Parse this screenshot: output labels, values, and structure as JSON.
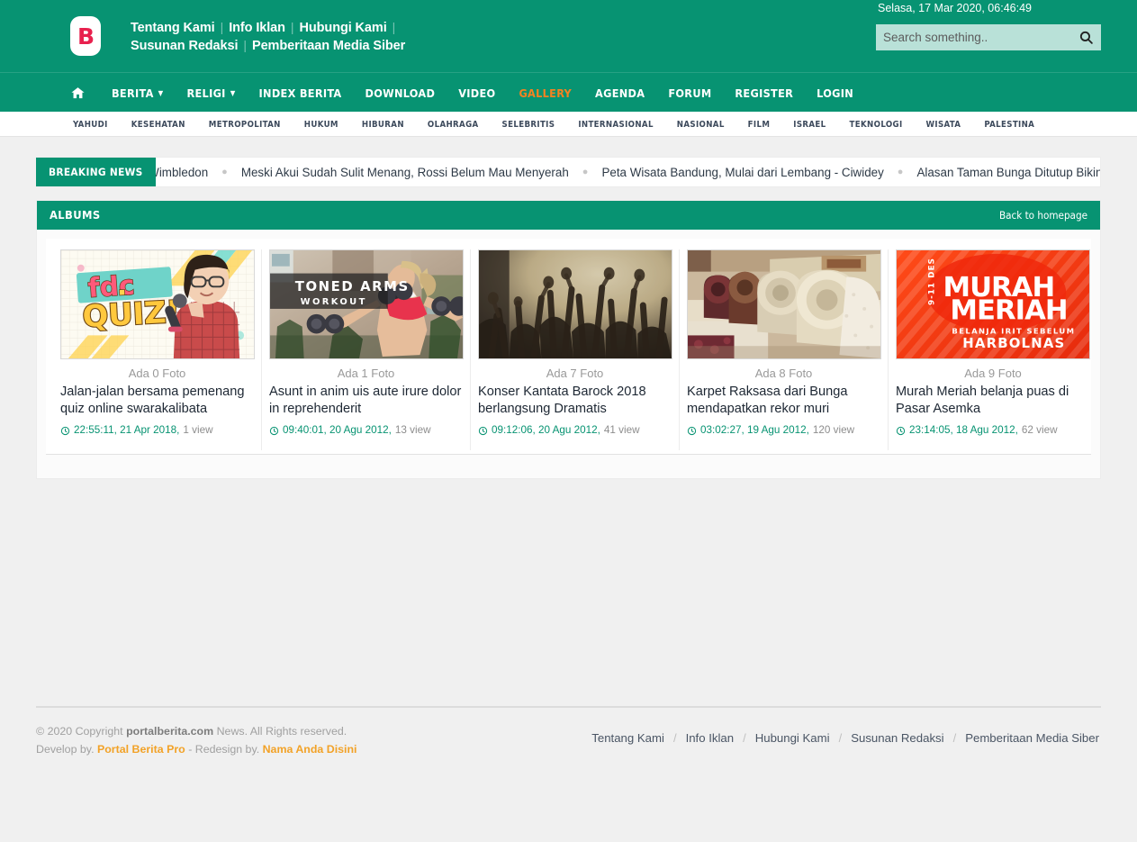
{
  "header": {
    "logo_letter": "B",
    "top_links": [
      "Tentang Kami",
      "Info Iklan",
      "Hubungi Kami",
      "Susunan Redaksi",
      "Pemberitaan Media Siber"
    ],
    "datetime": "Selasa, 17 Mar 2020, 06:46:49",
    "search_placeholder": "Search something..",
    "search_value": "",
    "brand_color": "#079372",
    "accent_color": "#f58220"
  },
  "nav": {
    "home_icon": "home-icon",
    "items": [
      {
        "label": "BERITA",
        "active": false,
        "dropdown": true
      },
      {
        "label": "RELIGI",
        "active": false,
        "dropdown": true
      },
      {
        "label": "INDEX BERITA",
        "active": false,
        "dropdown": false
      },
      {
        "label": "DOWNLOAD",
        "active": false,
        "dropdown": false
      },
      {
        "label": "VIDEO",
        "active": false,
        "dropdown": false
      },
      {
        "label": "GALLERY",
        "active": true,
        "dropdown": false
      },
      {
        "label": "AGENDA",
        "active": false,
        "dropdown": false
      },
      {
        "label": "FORUM",
        "active": false,
        "dropdown": false
      },
      {
        "label": "REGISTER",
        "active": false,
        "dropdown": false
      },
      {
        "label": "LOGIN",
        "active": false,
        "dropdown": false
      }
    ]
  },
  "categories": [
    "YAHUDI",
    "KESEHATAN",
    "METROPOLITAN",
    "HUKUM",
    "HIBURAN",
    "OLAHRAGA",
    "SELEBRITIS",
    "INTERNASIONAL",
    "NASIONAL",
    "FILM",
    "ISRAEL",
    "TEKNOLOGI",
    "WISATA",
    "PALESTINA"
  ],
  "breaking": {
    "label": "BREAKING NEWS",
    "items": [
      "ic Juara Wimbledon",
      "Meski Akui Sudah Sulit Menang, Rossi Belum Mau Menyerah",
      "Peta Wisata Bandung, Mulai dari Lembang - Ciwidey",
      "Alasan Taman Bunga Ditutup Bikin C"
    ]
  },
  "panel": {
    "title": "ALBUMS",
    "back_link": "Back to homepage"
  },
  "albums": [
    {
      "photo_count": "Ada 0 Foto",
      "title": "Jalan-jalan bersama pemenang quiz online swarakalibata",
      "time": "22:55:11, 21 Apr 2018,",
      "views": "1 view",
      "thumb": "fdc-quiz-poster"
    },
    {
      "photo_count": "Ada 1 Foto",
      "title": "Asunt in anim uis aute irure dolor in reprehenderit",
      "time": "09:40:01, 20 Agu 2012,",
      "views": "13 view",
      "thumb": "toned-arms-workout-photo"
    },
    {
      "photo_count": "Ada 7 Foto",
      "title": "Konser Kantata Barock 2018 berlangsung Dramatis",
      "time": "09:12:06, 20 Agu 2012,",
      "views": "41 view",
      "thumb": "concert-crowd-photo"
    },
    {
      "photo_count": "Ada 8 Foto",
      "title": "Karpet Raksasa dari Bunga mendapatkan rekor muri",
      "time": "03:02:27, 19 Agu 2012,",
      "views": "120 view",
      "thumb": "rolled-carpets-photo"
    },
    {
      "photo_count": "Ada 9 Foto",
      "title": "Murah Meriah belanja puas di Pasar Asemka",
      "time": "23:14:05, 18 Agu 2012,",
      "views": "62 view",
      "thumb": "murah-meriah-banner"
    }
  ],
  "thumb_text": {
    "quiz_line1": "fdc",
    "quiz_line2": "QUIZ!",
    "workout_line1": "TONED ARMS",
    "workout_line2": "WORKOUT",
    "murah_date": "9-11 DES",
    "murah_line1": "MURAH",
    "murah_line2": "MERIAH",
    "murah_line3": "BELANJA IRIT SEBELUM",
    "murah_line4": "HARBOLNAS"
  },
  "footer": {
    "copyright_pre": "© 2020 Copyright ",
    "copyright_brand": "portalberita.com",
    "copyright_post": " News. All Rights reserved.",
    "develop_pre": "Develop by. ",
    "develop_link": "Portal Berita Pro",
    "redesign_pre": " - Redesign by. ",
    "redesign_link": "Nama Anda Disini",
    "links": [
      "Tentang Kami",
      "Info Iklan",
      "Hubungi Kami",
      "Susunan Redaksi",
      "Pemberitaan Media Siber"
    ]
  }
}
